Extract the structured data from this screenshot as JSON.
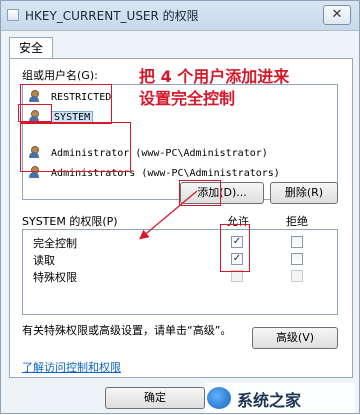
{
  "window": {
    "title": "HKEY_CURRENT_USER 的权限",
    "close_glyph": "✕"
  },
  "tabs": [
    {
      "label": "安全"
    }
  ],
  "groups": {
    "label": "组或用户名(G):",
    "items": [
      {
        "name": "RESTRICTED"
      },
      {
        "name": "SYSTEM"
      },
      {
        "name": "Administrator (www-PC\\Administrator)"
      },
      {
        "name": "Administrators (www-PC\\Administrators)"
      }
    ]
  },
  "buttons": {
    "add": "添加(D)...",
    "remove": "删除(R)",
    "advanced": "高级(V)",
    "ok": "确定"
  },
  "permissions": {
    "label": "SYSTEM 的权限(P)",
    "col_allow": "允许",
    "col_deny": "拒绝",
    "rows": [
      {
        "name": "完全控制",
        "allow": true,
        "deny": false
      },
      {
        "name": "读取",
        "allow": true,
        "deny": false
      },
      {
        "name": "特殊权限",
        "allow": false,
        "deny": false
      }
    ]
  },
  "special_text": "有关特殊权限或高级设置，请单击“高级”。",
  "link_text": "了解访问控制和权限",
  "annotation": {
    "line1": "把 4 个用户添加进来",
    "line2": "设置完全控制",
    "color": "#d6182a"
  },
  "watermark": {
    "text": "系统之家"
  },
  "checkmark_glyph": "✓"
}
